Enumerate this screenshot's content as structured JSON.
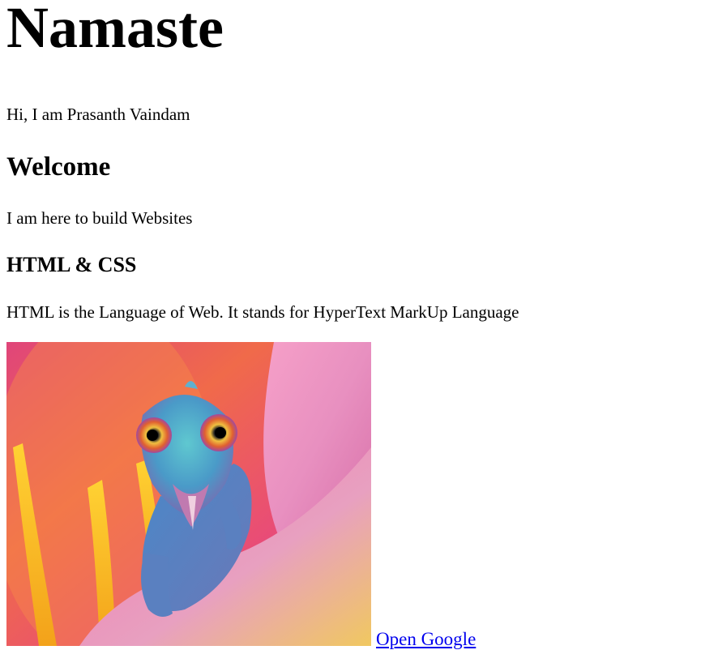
{
  "page": {
    "heading": "Namaste",
    "intro": "Hi, I am Prasanth Vaindam",
    "welcome_heading": "Welcome",
    "build_text": "I am here to build Websites",
    "sub_heading": "HTML & CSS",
    "html_description": "HTML is the Language of Web. It stands for HyperText MarkUp Language",
    "link_label": "Open Google"
  },
  "image": {
    "subject": "chameleon-on-flower-petal"
  },
  "colors": {
    "link": "#0000ee",
    "text": "#000000",
    "background": "#ffffff"
  }
}
